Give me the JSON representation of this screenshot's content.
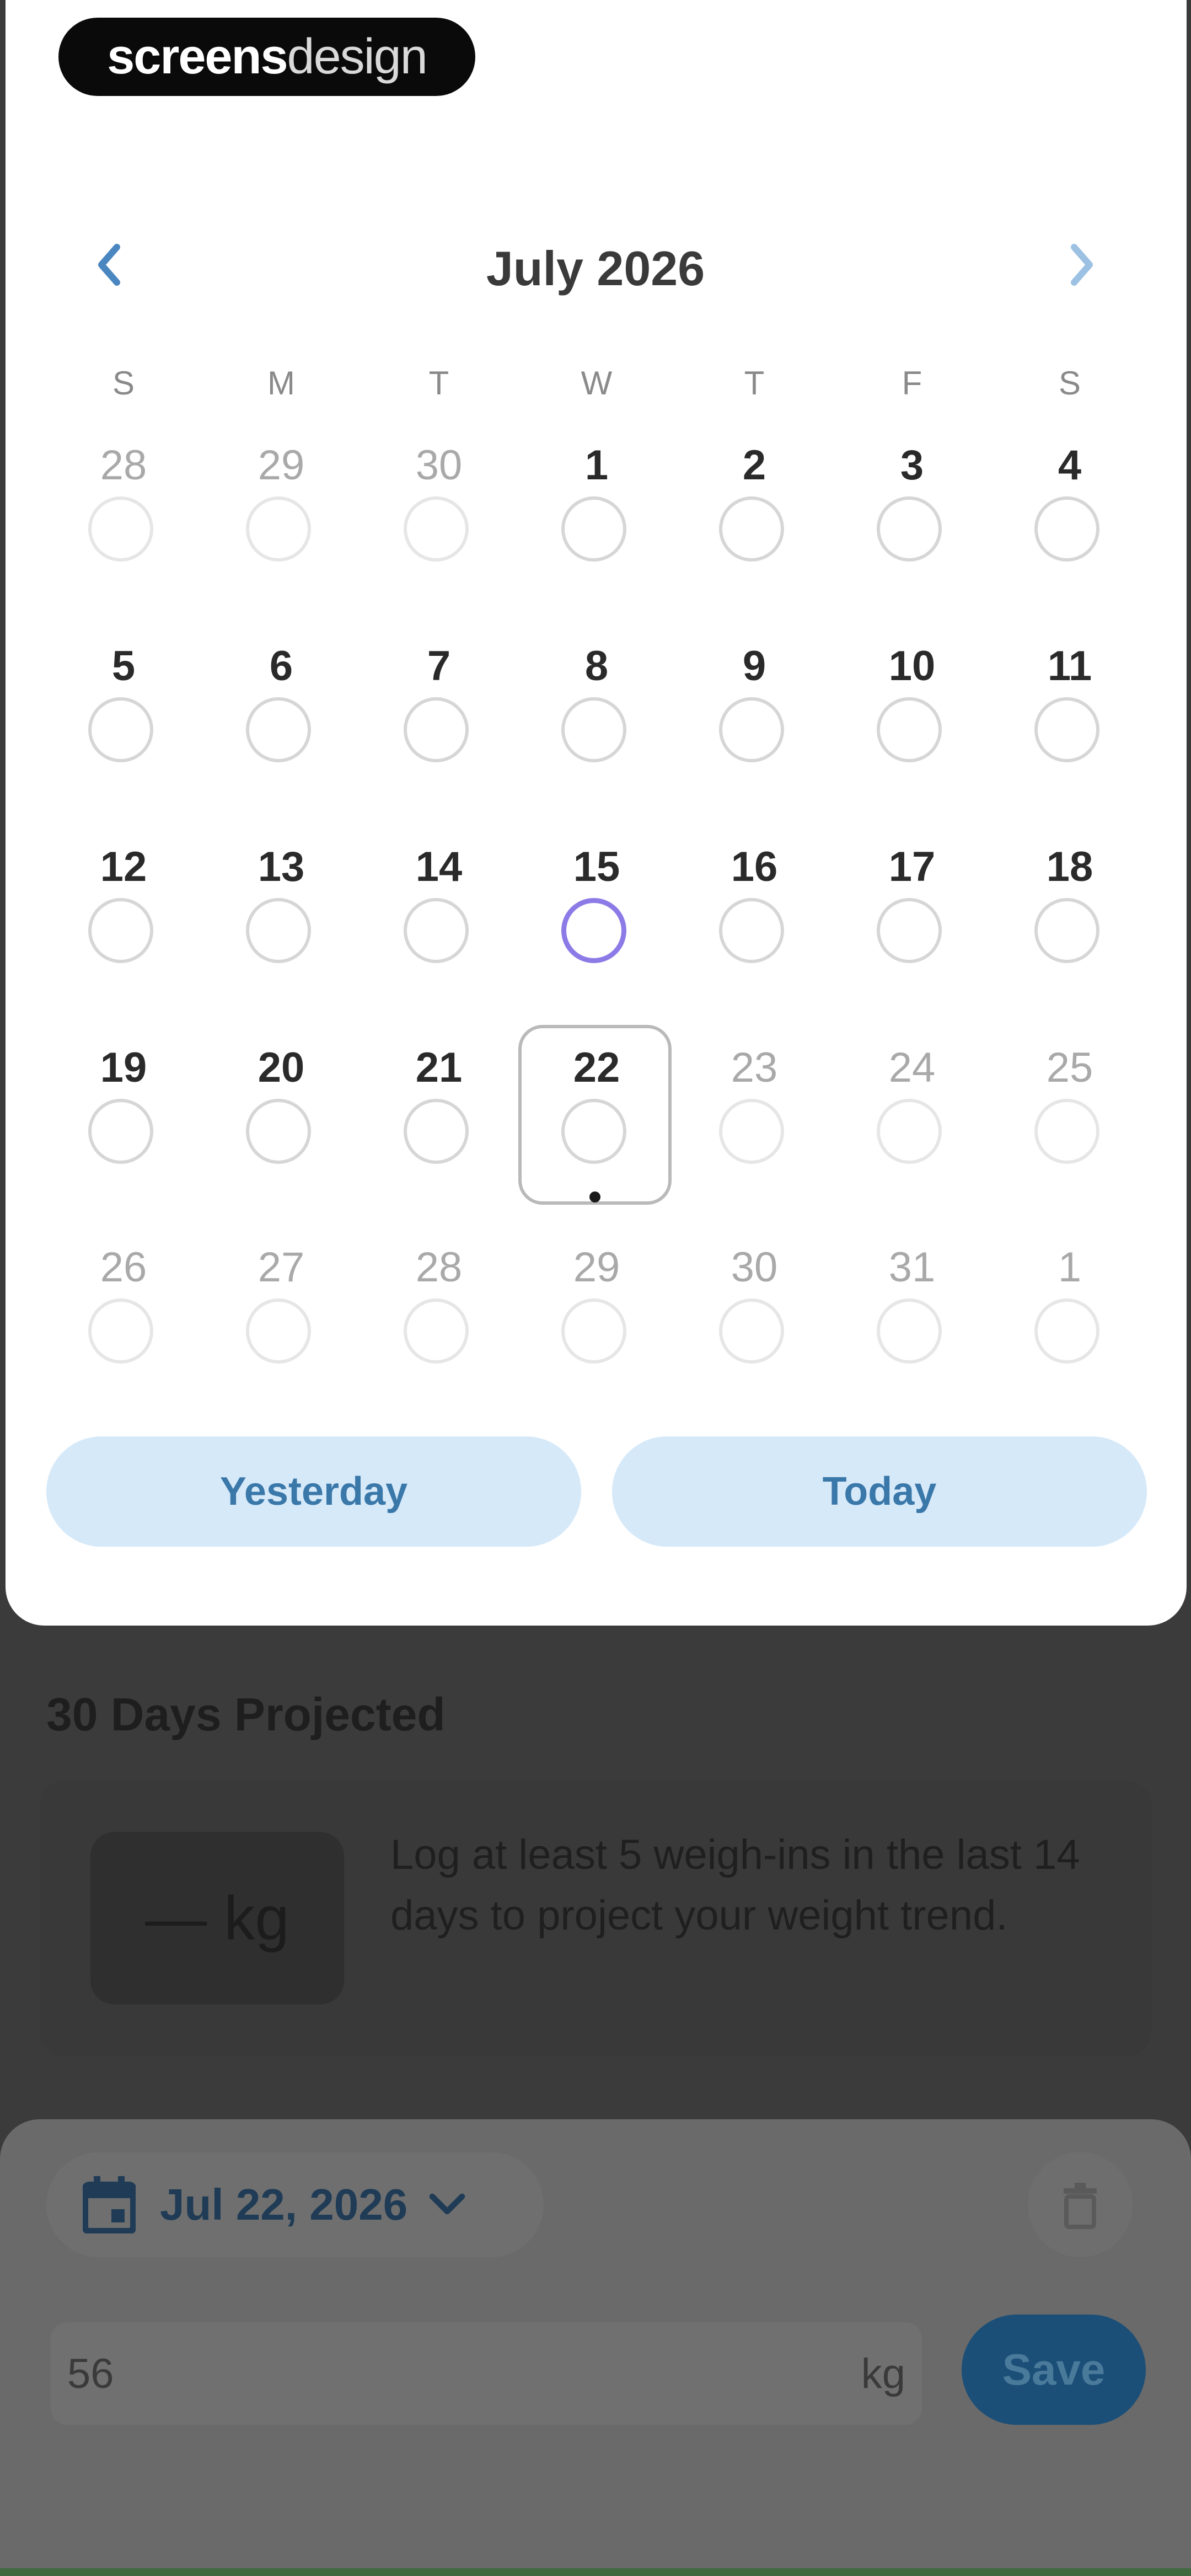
{
  "logo": {
    "bold_text": "screens",
    "thin_text": "design"
  },
  "calendar": {
    "month_title": "July 2026",
    "weekdays": [
      "S",
      "M",
      "T",
      "W",
      "T",
      "F",
      "S"
    ],
    "weeks": [
      [
        {
          "day": "28",
          "state": "muted"
        },
        {
          "day": "29",
          "state": "muted"
        },
        {
          "day": "30",
          "state": "muted"
        },
        {
          "day": "1",
          "state": "normal"
        },
        {
          "day": "2",
          "state": "normal"
        },
        {
          "day": "3",
          "state": "normal"
        },
        {
          "day": "4",
          "state": "normal"
        }
      ],
      [
        {
          "day": "5",
          "state": "normal"
        },
        {
          "day": "6",
          "state": "normal"
        },
        {
          "day": "7",
          "state": "normal"
        },
        {
          "day": "8",
          "state": "normal"
        },
        {
          "day": "9",
          "state": "normal"
        },
        {
          "day": "10",
          "state": "normal"
        },
        {
          "day": "11",
          "state": "normal"
        }
      ],
      [
        {
          "day": "12",
          "state": "normal"
        },
        {
          "day": "13",
          "state": "normal"
        },
        {
          "day": "14",
          "state": "normal"
        },
        {
          "day": "15",
          "state": "highlight"
        },
        {
          "day": "16",
          "state": "normal"
        },
        {
          "day": "17",
          "state": "normal"
        },
        {
          "day": "18",
          "state": "normal"
        }
      ],
      [
        {
          "day": "19",
          "state": "normal"
        },
        {
          "day": "20",
          "state": "normal"
        },
        {
          "day": "21",
          "state": "normal"
        },
        {
          "day": "22",
          "state": "selected"
        },
        {
          "day": "23",
          "state": "muted"
        },
        {
          "day": "24",
          "state": "muted"
        },
        {
          "day": "25",
          "state": "muted"
        }
      ],
      [
        {
          "day": "26",
          "state": "muted"
        },
        {
          "day": "27",
          "state": "muted"
        },
        {
          "day": "28",
          "state": "muted"
        },
        {
          "day": "29",
          "state": "muted"
        },
        {
          "day": "30",
          "state": "muted"
        },
        {
          "day": "31",
          "state": "muted"
        },
        {
          "day": "1",
          "state": "muted"
        }
      ]
    ],
    "buttons": {
      "yesterday": "Yesterday",
      "today": "Today"
    }
  },
  "background": {
    "projection_title": "30 Days Projected",
    "projection_value": "— kg",
    "projection_message": "Log at least 5 weigh-ins in the last 14 days to project your weight trend.",
    "date_chip": "Jul 22, 2026",
    "weight_value": "56",
    "weight_unit": "kg",
    "save_label": "Save"
  },
  "colors": {
    "accent_blue": "#3a78aa",
    "pill_bg": "#d6e9f9",
    "highlight_purple": "#8c7be6"
  }
}
